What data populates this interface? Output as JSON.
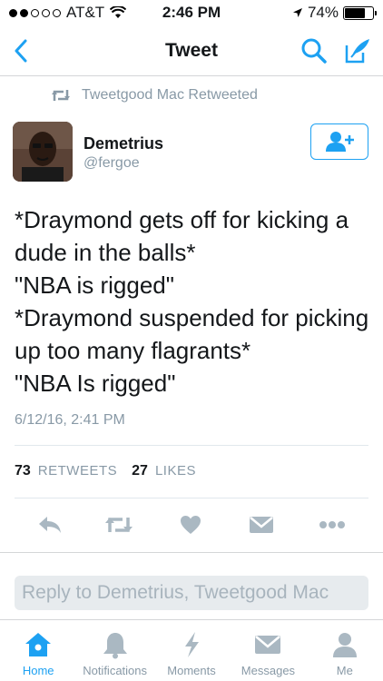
{
  "status_bar": {
    "carrier": "AT&T",
    "time": "2:46 PM",
    "battery": "74%",
    "battery_level": 0.74,
    "signal_bars": 2
  },
  "nav": {
    "title": "Tweet",
    "back_icon": "chevron-left-icon",
    "search_icon": "search-icon",
    "compose_icon": "compose-icon"
  },
  "retweet_context": {
    "text": "Tweetgood Mac Retweeted",
    "icon": "retweet-icon"
  },
  "tweet": {
    "author_name": "Demetrius",
    "author_handle": "@fergoe",
    "follow_icon": "follow-user-icon",
    "text_lines": [
      "*Draymond gets off for kicking a",
      "dude in the balls*",
      "\"NBA is rigged\"",
      "*Draymond suspended for picking",
      "up too many flagrants*",
      "\"NBA Is rigged\""
    ],
    "timestamp": "6/12/16, 2:41 PM",
    "retweets": "73",
    "retweets_label": "RETWEETS",
    "likes": "27",
    "likes_label": "LIKES"
  },
  "actions": [
    {
      "name": "reply-icon"
    },
    {
      "name": "retweet-icon"
    },
    {
      "name": "like-icon"
    },
    {
      "name": "message-icon"
    },
    {
      "name": "more-icon"
    }
  ],
  "reply": {
    "placeholder": "Reply to Demetrius, Tweetgood Mac"
  },
  "tab_bar": {
    "tabs": [
      {
        "label": "Home",
        "icon": "home-icon",
        "active": true
      },
      {
        "label": "Notifications",
        "icon": "notifications-icon",
        "active": false
      },
      {
        "label": "Moments",
        "icon": "moments-icon",
        "active": false
      },
      {
        "label": "Messages",
        "icon": "messages-icon",
        "active": false
      },
      {
        "label": "Me",
        "icon": "profile-icon",
        "active": false
      }
    ]
  },
  "colors": {
    "accent": "#1da1f2",
    "muted": "#8899a6",
    "text": "#14171a",
    "action_gray": "#aab8c2"
  }
}
